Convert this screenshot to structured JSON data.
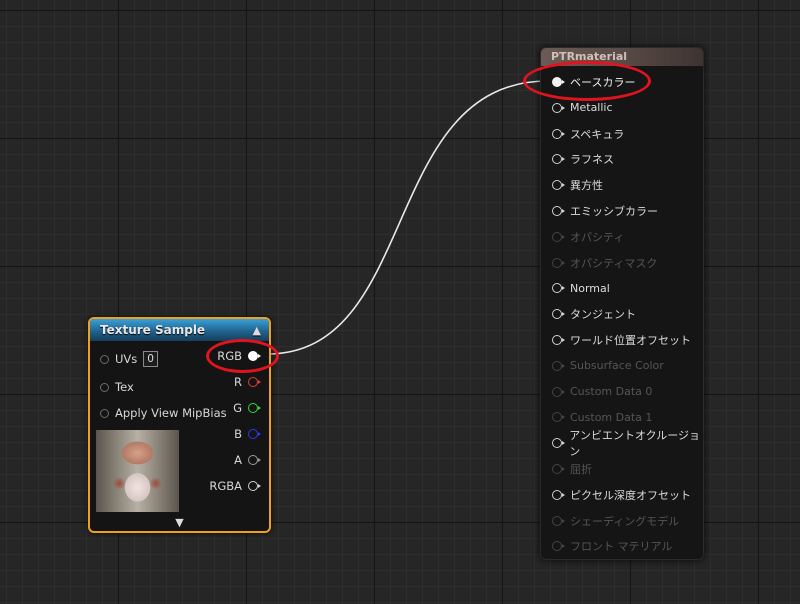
{
  "texture_node": {
    "title": "Texture Sample",
    "inputs": [
      {
        "label": "UVs",
        "value": "0"
      },
      {
        "label": "Tex"
      },
      {
        "label": "Apply View MipBias"
      }
    ],
    "outputs": [
      {
        "label": "RGB",
        "color": "#ffffff",
        "connected": true
      },
      {
        "label": "R",
        "color": "#e03a3a"
      },
      {
        "label": "G",
        "color": "#3ad23a"
      },
      {
        "label": "B",
        "color": "#2b3ae8"
      },
      {
        "label": "A",
        "color": "#9a9a9a"
      },
      {
        "label": "RGBA",
        "color": "#cfcfcf"
      }
    ],
    "collapse_icon": "chevron-up-icon",
    "expand_icon": "chevron-down-icon"
  },
  "material_node": {
    "title": "PTRmaterial",
    "pins": [
      {
        "label": "ベースカラー",
        "state": "connected"
      },
      {
        "label": "Metallic",
        "state": "active"
      },
      {
        "label": "スペキュラ",
        "state": "active"
      },
      {
        "label": "ラフネス",
        "state": "active"
      },
      {
        "label": "異方性",
        "state": "active"
      },
      {
        "label": "エミッシブカラー",
        "state": "active"
      },
      {
        "label": "オパシティ",
        "state": "disabled"
      },
      {
        "label": "オパシティマスク",
        "state": "disabled"
      },
      {
        "label": "Normal",
        "state": "active"
      },
      {
        "label": "タンジェント",
        "state": "active"
      },
      {
        "label": "ワールド位置オフセット",
        "state": "active"
      },
      {
        "label": "Subsurface Color",
        "state": "disabled"
      },
      {
        "label": "Custom Data 0",
        "state": "disabled"
      },
      {
        "label": "Custom Data 1",
        "state": "disabled"
      },
      {
        "label": "アンビエントオクルージョン",
        "state": "active"
      },
      {
        "label": "屈折",
        "state": "disabled"
      },
      {
        "label": "ピクセル深度オフセット",
        "state": "active"
      },
      {
        "label": "シェーディングモデル",
        "state": "disabled"
      },
      {
        "label": "フロント マテリアル",
        "state": "disabled"
      }
    ]
  },
  "colors": {
    "node_selection": "#f0a020",
    "highlight": "#e0141e",
    "wire": "#e8e8e8"
  }
}
